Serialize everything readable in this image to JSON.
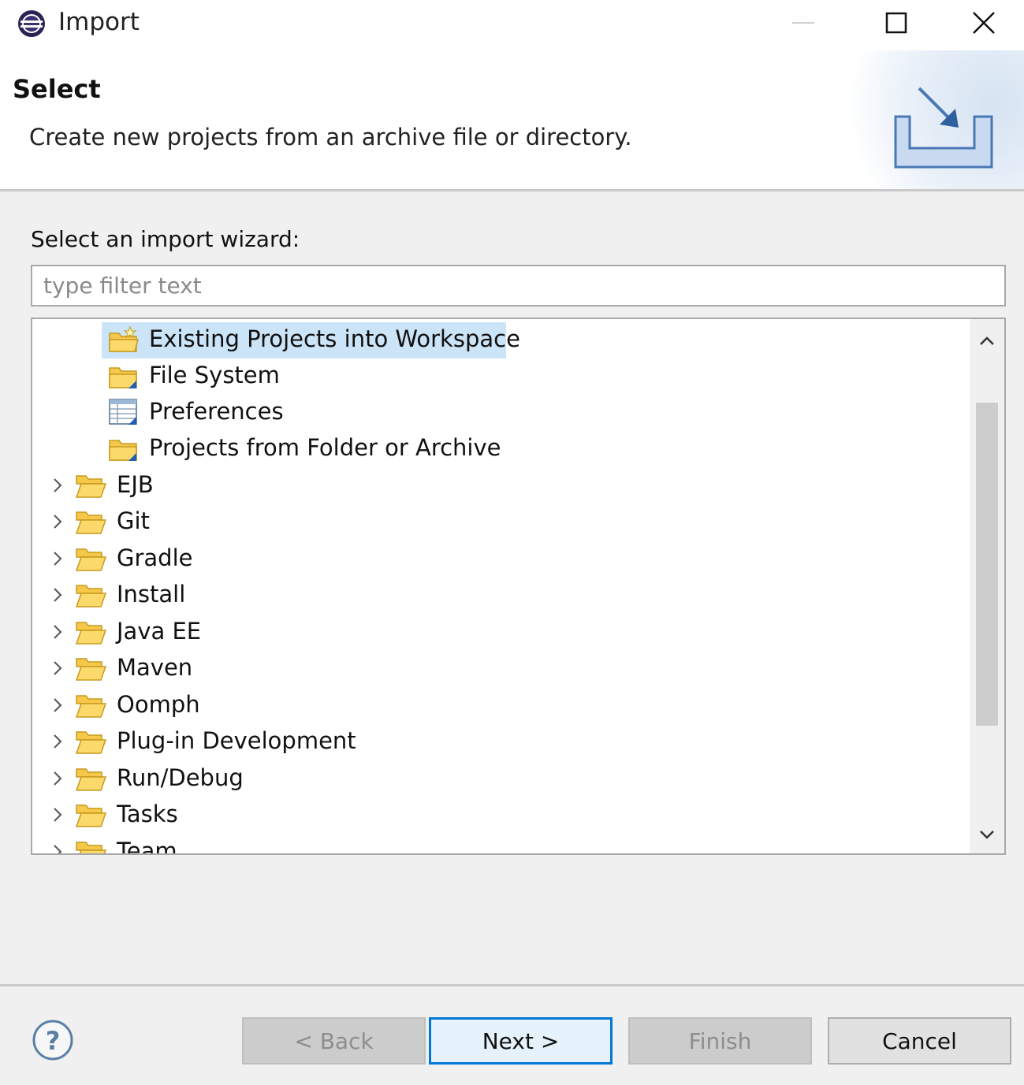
{
  "window": {
    "title": "Import",
    "app_icon": "eclipse-icon",
    "controls": [
      "minimize-icon",
      "maximize-icon",
      "close-icon"
    ]
  },
  "banner": {
    "title": "Select",
    "description": "Create new projects from an archive file or directory.",
    "graphic": "import-wizard-icon"
  },
  "filter": {
    "label": "Select an import wizard:",
    "placeholder": "type filter text",
    "value": ""
  },
  "tree": {
    "items": [
      {
        "label": "Existing Projects into Workspace",
        "icon": "existing-project-icon",
        "level": 2,
        "selected": true
      },
      {
        "label": "File System",
        "icon": "folder-import-icon",
        "level": 2
      },
      {
        "label": "Preferences",
        "icon": "preferences-icon",
        "level": 2
      },
      {
        "label": "Projects from Folder or Archive",
        "icon": "folder-import-icon",
        "level": 2
      },
      {
        "label": "EJB",
        "icon": "folder-open-icon",
        "level": 1,
        "expandable": true
      },
      {
        "label": "Git",
        "icon": "folder-open-icon",
        "level": 1,
        "expandable": true
      },
      {
        "label": "Gradle",
        "icon": "folder-open-icon",
        "level": 1,
        "expandable": true
      },
      {
        "label": "Install",
        "icon": "folder-open-icon",
        "level": 1,
        "expandable": true
      },
      {
        "label": "Java EE",
        "icon": "folder-open-icon",
        "level": 1,
        "expandable": true
      },
      {
        "label": "Maven",
        "icon": "folder-open-icon",
        "level": 1,
        "expandable": true
      },
      {
        "label": "Oomph",
        "icon": "folder-open-icon",
        "level": 1,
        "expandable": true
      },
      {
        "label": "Plug-in Development",
        "icon": "folder-open-icon",
        "level": 1,
        "expandable": true
      },
      {
        "label": "Run/Debug",
        "icon": "folder-open-icon",
        "level": 1,
        "expandable": true
      },
      {
        "label": "Tasks",
        "icon": "folder-open-icon",
        "level": 1,
        "expandable": true
      },
      {
        "label": "Team",
        "icon": "folder-open-icon",
        "level": 1,
        "expandable": true
      }
    ]
  },
  "buttons": {
    "help_icon": "help-icon",
    "back": "< Back",
    "next": "Next >",
    "finish": "Finish",
    "cancel": "Cancel"
  },
  "colors": {
    "selection": "#cce4f7",
    "default_button_border": "#0078d7",
    "folder": "#f5c84c"
  }
}
